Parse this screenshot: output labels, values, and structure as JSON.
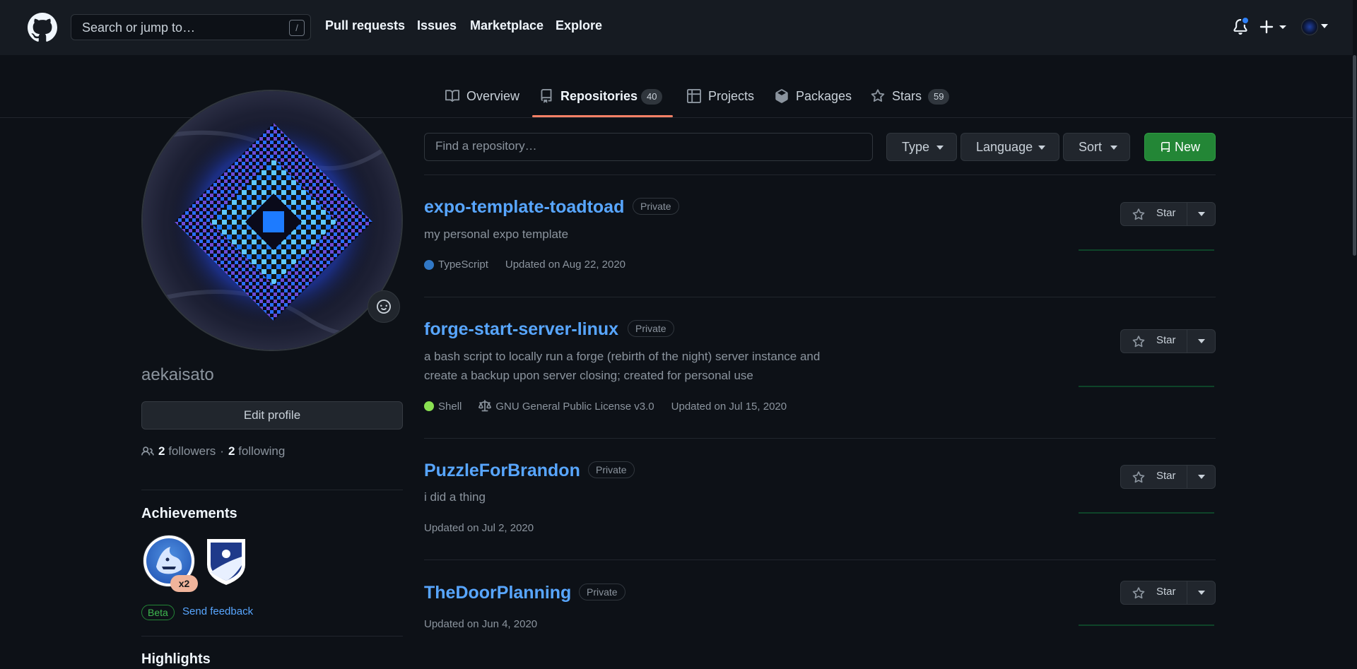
{
  "header": {
    "search_placeholder": "Search or jump to…",
    "search_shortcut": "/",
    "nav": [
      "Pull requests",
      "Issues",
      "Marketplace",
      "Explore"
    ]
  },
  "tabs": [
    {
      "label": "Overview",
      "icon": "book-icon"
    },
    {
      "label": "Repositories",
      "count": "40",
      "icon": "repo-icon",
      "active": true
    },
    {
      "label": "Projects",
      "icon": "table-icon"
    },
    {
      "label": "Packages",
      "icon": "package-icon"
    },
    {
      "label": "Stars",
      "count": "59",
      "icon": "star-icon"
    }
  ],
  "profile": {
    "username": "aekaisato",
    "edit_label": "Edit profile",
    "followers_count": "2",
    "followers_label": "followers",
    "separator": "·",
    "following_count": "2",
    "following_label": "following",
    "achievements_title": "Achievements",
    "achievement_multiplier": "x2",
    "beta_label": "Beta",
    "feedback_label": "Send feedback",
    "highlights_title": "Highlights"
  },
  "repo_controls": {
    "find_placeholder": "Find a repository…",
    "type_label": "Type",
    "language_label": "Language",
    "sort_label": "Sort",
    "new_label": "New"
  },
  "repos": [
    {
      "name": "expo-template-toadtoad",
      "visibility": "Private",
      "description": "my personal expo template",
      "language": "TypeScript",
      "language_color": "#3178c6",
      "updated": "Updated on Aug 22, 2020"
    },
    {
      "name": "forge-start-server-linux",
      "visibility": "Private",
      "description_line1": "a bash script to locally run a forge (rebirth of the night) server instance and",
      "description_line2": "create a backup upon server closing; created for personal use",
      "language": "Shell",
      "language_color": "#89e051",
      "license": "GNU General Public License v3.0",
      "updated": "Updated on Jul 15, 2020"
    },
    {
      "name": "PuzzleForBrandon",
      "visibility": "Private",
      "description": "i did a thing",
      "updated": "Updated on Jul 2, 2020"
    },
    {
      "name": "TheDoorPlanning",
      "visibility": "Private",
      "updated": "Updated on Jun 4, 2020"
    }
  ],
  "star_label": "Star",
  "colors": {
    "accent": "#58a6ff",
    "tab_underline": "#f78166",
    "new_button": "#238636",
    "background": "#0d1117"
  }
}
